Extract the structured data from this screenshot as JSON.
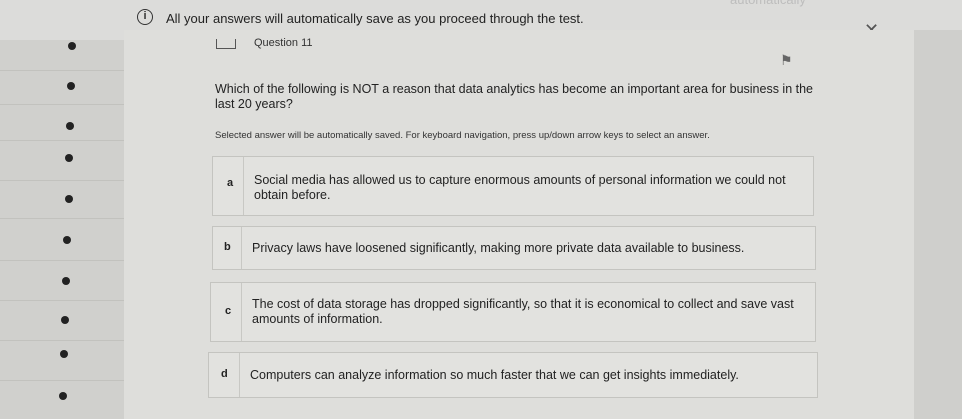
{
  "banner": {
    "message": "All your answers will automatically save as you proceed through the test.",
    "faded_text": "automatically"
  },
  "question": {
    "label": "Question 11",
    "text": "Which of the following is NOT a reason that data analytics has become an important area for business in the last 20 years?",
    "instruction": "Selected answer will be automatically saved. For keyboard navigation, press up/down arrow keys to select an answer."
  },
  "answers": [
    {
      "letter": "a",
      "text": "Social media has allowed us to capture enormous amounts of personal information we could not obtain before."
    },
    {
      "letter": "b",
      "text": "Privacy laws have loosened significantly, making more private data available to business."
    },
    {
      "letter": "c",
      "text": "The cost of data storage has dropped significantly, so that it is economical to collect and save vast amounts of information."
    },
    {
      "letter": "d",
      "text": "Computers can analyze information so much faster that we can get insights immediately."
    }
  ],
  "icons": {
    "info": "info-icon",
    "close": "close-icon",
    "flag": "flag-icon",
    "question": "question-icon"
  },
  "rail_dot_count": 10
}
